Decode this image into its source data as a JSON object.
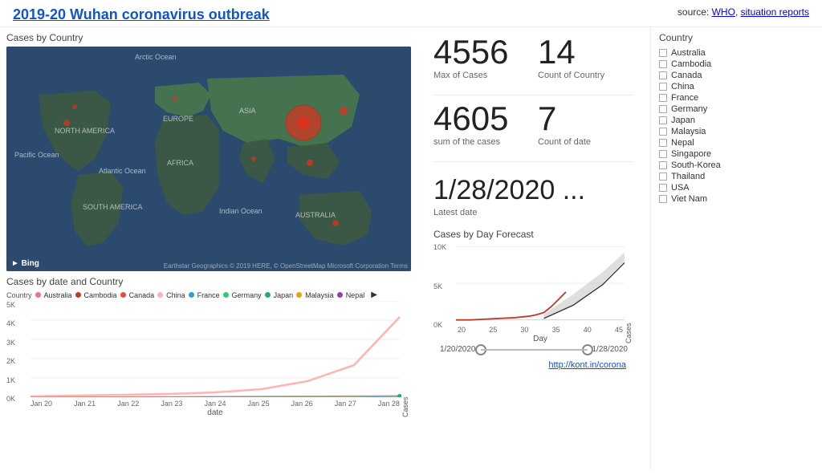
{
  "header": {
    "title": "2019-20 Wuhan coronavirus outbreak",
    "source_label": "source:",
    "source_who": "WHO",
    "source_reports": "situation reports"
  },
  "stats": {
    "max_cases_value": "4556",
    "max_cases_label": "Max of Cases",
    "count_country_value": "14",
    "count_country_label": "Count of Country",
    "sum_cases_value": "4605",
    "sum_cases_label": "sum of the cases",
    "count_date_value": "7",
    "count_date_label": "Count of date",
    "latest_date_value": "1/28/2020 ...",
    "latest_date_label": "Latest date"
  },
  "country_filter": {
    "title": "Country",
    "countries": [
      "Australia",
      "Cambodia",
      "Canada",
      "China",
      "France",
      "Germany",
      "Japan",
      "Malaysia",
      "Nepal",
      "Singapore",
      "South-Korea",
      "Thailand",
      "USA",
      "Viet Nam"
    ]
  },
  "chart_left": {
    "title": "Cases by date and Country",
    "country_label": "Country",
    "legend": [
      {
        "name": "Australia",
        "color": "#e87a7a"
      },
      {
        "name": "Cambodia",
        "color": "#c0392b"
      },
      {
        "name": "Canada",
        "color": "#e74c3c"
      },
      {
        "name": "China",
        "color": "#ffb3b3"
      },
      {
        "name": "France",
        "color": "#3498db"
      },
      {
        "name": "Germany",
        "color": "#2ecc71"
      },
      {
        "name": "Japan",
        "color": "#27ae60"
      },
      {
        "name": "Malaysia",
        "color": "#f39c12"
      },
      {
        "name": "Nepal",
        "color": "#8e44ad"
      }
    ],
    "y_label": "Cases",
    "x_label": "date",
    "y_ticks": [
      "5K",
      "4K",
      "3K",
      "2K",
      "1K",
      "0K"
    ],
    "x_ticks": [
      "Jan 20",
      "Jan 21",
      "Jan 22",
      "Jan 23",
      "Jan 24",
      "Jan 25",
      "Jan 26",
      "Jan 27",
      "Jan 28"
    ]
  },
  "chart_right": {
    "title": "Cases by Day Forecast",
    "y_label": "Cases",
    "x_label": "Day",
    "y_ticks": [
      "10K",
      "5K",
      "0K"
    ],
    "x_ticks": [
      "20",
      "25",
      "30",
      "35",
      "40",
      "45"
    ],
    "slider_start": "1/20/2020",
    "slider_end": "1/28/2020"
  },
  "footer": {
    "link_text": "http://kont.in/corona"
  },
  "map": {
    "labels": {
      "arctic": "Arctic Ocean",
      "pacific": "Pacific Ocean",
      "atlantic": "Atlantic Ocean",
      "north_am": "NORTH AMERICA",
      "south_am": "SOUTH AMERICA",
      "europe": "EUROPE",
      "africa": "AFRICA",
      "asia": "ASIA",
      "indian": "Indian Ocean",
      "australia": "AUSTRALIA"
    }
  }
}
